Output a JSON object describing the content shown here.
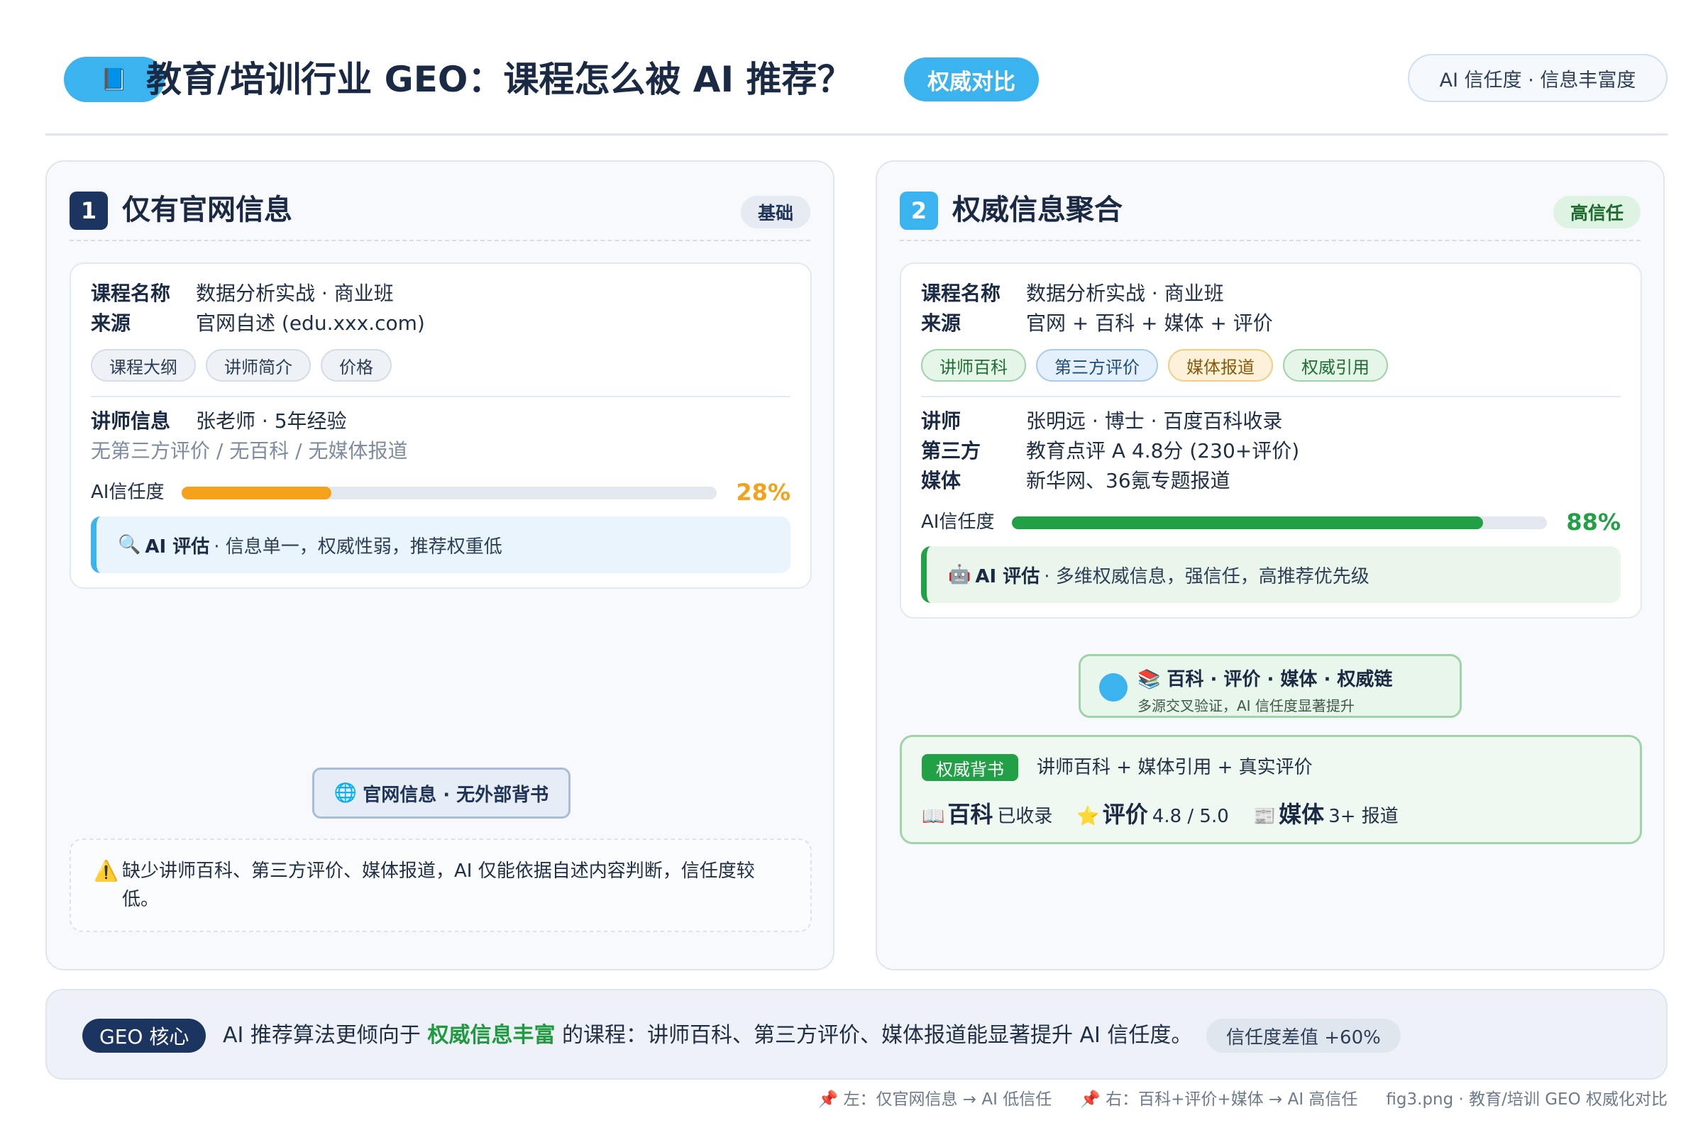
{
  "header": {
    "logo_icon": "📘",
    "title": "教育/培训行业 GEO：课程怎么被 AI 推荐？",
    "badge": "权威对比",
    "right_pill": "AI 信任度 · 信息丰富度"
  },
  "left": {
    "number": "1",
    "title": "仅有官网信息",
    "level": "基础",
    "course_key": "课程名称",
    "course_val": "数据分析实战 · 商业班",
    "source_key": "来源",
    "source_val": "官网自述 (edu.xxx.com)",
    "chips": [
      "课程大纲",
      "讲师简介",
      "价格"
    ],
    "teacher_key": "讲师信息",
    "teacher_val": "张老师 · 5年经验",
    "missing": "无第三方评价 / 无百科 / 无媒体报道",
    "trust_label": "AI信任度",
    "trust_value": 0.28,
    "trust_pct": "28%",
    "trust_color": "#f4a21b",
    "eval_icon": "🔍",
    "eval_title": "AI 评估",
    "eval_text": "· 信息单一，权威性弱，推荐权重低",
    "source_pill_icon": "🌐",
    "source_pill": "官网信息 · 无外部背书",
    "warn_icon": "⚠️",
    "warn_text": "缺少讲师百科、第三方评价、媒体报道，AI 仅能依据自述内容判断，信任度较低。"
  },
  "right": {
    "number": "2",
    "title": "权威信息聚合",
    "level": "高信任",
    "course_key": "课程名称",
    "course_val": "数据分析实战 · 商业班",
    "source_key": "来源",
    "source_val": "官网 + 百科 + 媒体 + 评价",
    "chips": [
      {
        "label": "讲师百科",
        "tone": "green"
      },
      {
        "label": "第三方评价",
        "tone": "blue"
      },
      {
        "label": "媒体报道",
        "tone": "yellow"
      },
      {
        "label": "权威引用",
        "tone": "green"
      }
    ],
    "teacher_key": "讲师",
    "teacher_val": "张明远 · 博士 · 百度百科收录",
    "third_key": "第三方",
    "third_val": "教育点评 A 4.8分 (230+评价)",
    "media_key": "媒体",
    "media_val": "新华网、36氪专题报道",
    "trust_label": "AI信任度",
    "trust_value": 0.88,
    "trust_pct": "88%",
    "trust_color": "#22a046",
    "eval_icon": "🤖",
    "eval_title": "AI 评估",
    "eval_text": "· 多维权威信息，强信任，高推荐优先级",
    "chain_title": "📚 百科 · 评价 · 媒体 · 权威链",
    "chain_sub": "多源交叉验证，AI 信任度显著提升",
    "endorse_tag": "权威背书",
    "endorse_text": "讲师百科 + 媒体引用 + 真实评价",
    "stats": [
      {
        "icon": "📖",
        "name": "百科",
        "value": "已收录"
      },
      {
        "icon": "⭐",
        "name": "评价",
        "value": "4.8 / 5.0"
      },
      {
        "icon": "📰",
        "name": "媒体",
        "value": "3+ 报道"
      }
    ]
  },
  "core": {
    "tag": "GEO 核心",
    "text_before": "AI 推荐算法更倾向于 ",
    "text_highlight": "权威信息丰富",
    "text_after": " 的课程：讲师百科、第三方评价、媒体报道能显著提升 AI 信任度。",
    "diff": "信任度差值 +60%"
  },
  "footer": {
    "left_note": "📌 左：仅官网信息 → AI 低信任",
    "right_note": "📌 右：百科+评价+媒体 → AI 高信任",
    "caption": "fig3.png · 教育/培训 GEO 权威化对比"
  }
}
